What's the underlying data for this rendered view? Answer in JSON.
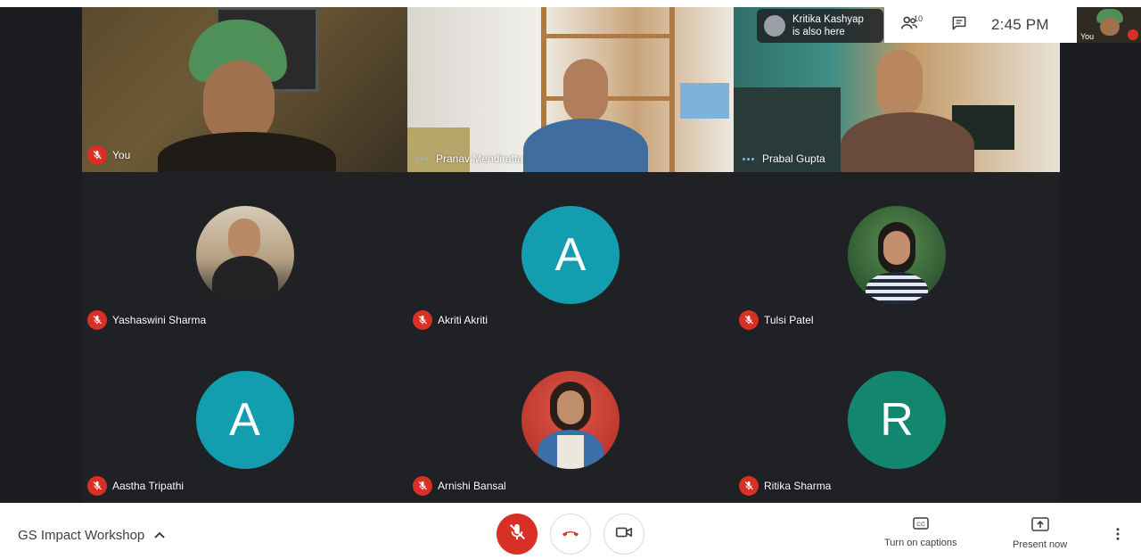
{
  "notification": {
    "line1": "Kritika Kashyap",
    "line2": "is also here"
  },
  "top_panel": {
    "participant_count": "10",
    "time": "2:45 PM"
  },
  "self_view": {
    "label": "You"
  },
  "video_tiles": [
    {
      "name": "You",
      "status": "muted"
    },
    {
      "name": "Pranav Mendiratta",
      "status": "speaking-dots"
    },
    {
      "name": "Prabal Gupta",
      "status": "speaking-dots"
    }
  ],
  "avatar_tiles": [
    {
      "name": "Yashaswini Sharma",
      "initial": "",
      "kind": "photo",
      "color": "#c9b79c"
    },
    {
      "name": "Akriti Akriti",
      "initial": "A",
      "kind": "letter",
      "color": "#129eaf"
    },
    {
      "name": "Tulsi Patel",
      "initial": "",
      "kind": "photo",
      "color": "#3d6b3f"
    },
    {
      "name": "Aastha Tripathi",
      "initial": "A",
      "kind": "letter",
      "color": "#129eaf"
    },
    {
      "name": "Arnishi Bansal",
      "initial": "",
      "kind": "photo",
      "color": "#c0392b"
    },
    {
      "name": "Ritika Sharma",
      "initial": "R",
      "kind": "letter",
      "color": "#12866f"
    }
  ],
  "bottom_bar": {
    "meeting_title": "GS Impact Workshop",
    "captions_label": "Turn on captions",
    "present_label": "Present now"
  },
  "icons": [
    "people-icon",
    "chat-icon",
    "mic-off-icon",
    "hangup-icon",
    "camera-icon",
    "captions-icon",
    "present-icon",
    "more-vert-icon",
    "chevron-up-icon"
  ]
}
